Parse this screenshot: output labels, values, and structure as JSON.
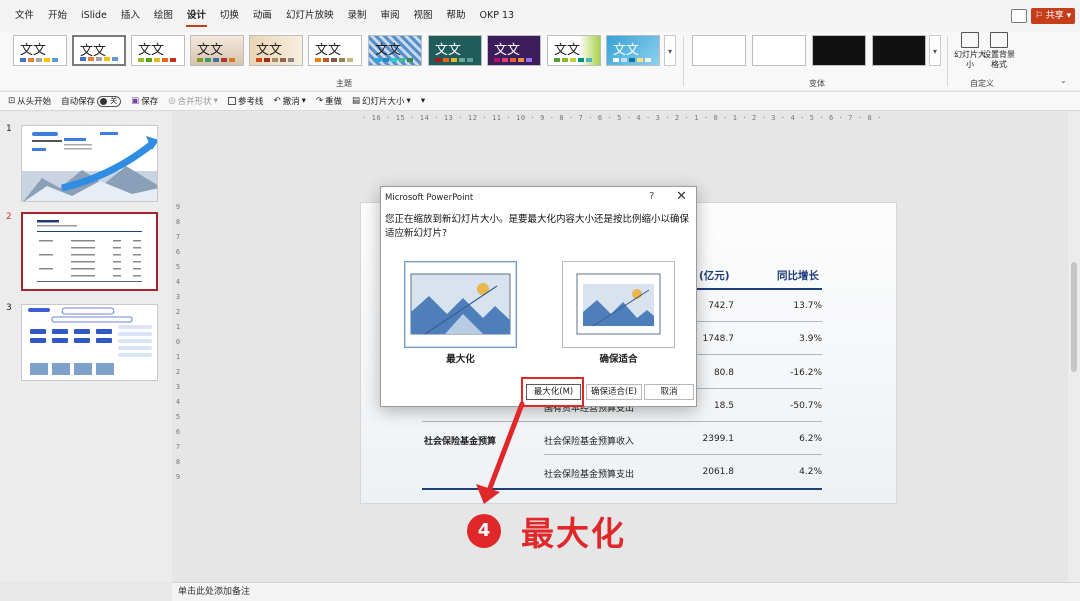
{
  "menubar": {
    "items": [
      "文件",
      "开始",
      "iSlide",
      "插入",
      "绘图",
      "设计",
      "切换",
      "动画",
      "幻灯片放映",
      "录制",
      "审阅",
      "视图",
      "帮助",
      "OKP 13"
    ],
    "active_index": 5,
    "share_label": "⚐ 共享 ▾"
  },
  "ribbon": {
    "theme_sample": "文文",
    "themes_group_label": "主题",
    "variants_group_label": "变体",
    "customize_group_label": "自定义",
    "slide_size_label": "幻灯片大小",
    "format_bg_label": "设置背景格式"
  },
  "qat": {
    "from_start": "从头开始",
    "autosave": "自动保存",
    "autosave_state": "关",
    "save": "保存",
    "merge_shapes": "合并形状",
    "guides": "参考线",
    "undo": "撤消",
    "redo": "重做",
    "slide_size": "幻灯片大小"
  },
  "slides": {
    "numbers": [
      "1",
      "2",
      "3"
    ],
    "selected": 2
  },
  "ruler": {
    "horizontal": "· 16 · 15 · 14 · 13 · 12 · 11 · 10 · 9 · 8 · 7 · 6 · 5 · 4 · 3 · 2 · 1 · 0 · 1 · 2 · 3 · 4 · 5 · 6 · 7 · 8 · 9 · 10 · 11 · 12 · 13 · 14 · 15 · 16 ·",
    "vertical": [
      "9",
      "8",
      "7",
      "6",
      "5",
      "4",
      "3",
      "2",
      "1",
      "0",
      "1",
      "2",
      "3",
      "4",
      "5",
      "6",
      "7",
      "8",
      "9"
    ]
  },
  "slide_table": {
    "header_amount": "(亿元)",
    "header_growth": "同比增长",
    "rows": [
      {
        "category": "",
        "item": "",
        "amount": "742.7",
        "growth": "13.7%"
      },
      {
        "category": "",
        "item": "",
        "amount": "1748.7",
        "growth": "3.9%"
      },
      {
        "category": "",
        "item": "",
        "amount": "80.8",
        "growth": "-16.2%"
      },
      {
        "category": "",
        "item": "国有资本经营预算支出",
        "amount": "18.5",
        "growth": "-50.7%"
      },
      {
        "category": "社会保险基金预算",
        "item": "社会保险基金预算收入",
        "amount": "2399.1",
        "growth": "6.2%"
      },
      {
        "category": "",
        "item": "社会保险基金预算支出",
        "amount": "2061.8",
        "growth": "4.2%"
      }
    ]
  },
  "dialog": {
    "title": "Microsoft PowerPoint",
    "help": "?",
    "close": "✕",
    "message": "您正在缩放到新幻灯片大小。是要最大化内容大小还是按比例缩小以确保适应新幻灯片?",
    "option_maximize": "最大化",
    "option_ensure_fit": "确保适合",
    "btn_maximize": "最大化(M)",
    "btn_ensure_fit": "确保适合(E)",
    "btn_cancel": "取消"
  },
  "annotation": {
    "step_number": "4",
    "step_text": "最大化",
    "color": "#e0282a"
  },
  "notes_placeholder": "单击此处添加备注",
  "colors": {
    "accent": "#c43e1c",
    "table_header": "#1f3f7a",
    "illustration_blue": "#4f7fba",
    "illustration_sun": "#e8b64c"
  }
}
